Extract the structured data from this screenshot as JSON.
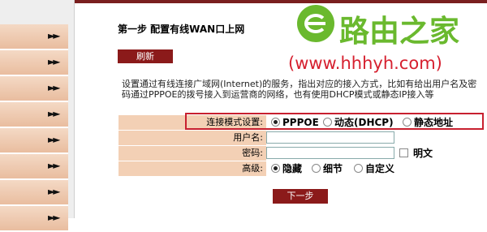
{
  "sidebar": {
    "items": [
      {
        "arrow": "►►"
      },
      {
        "arrow": "►►"
      },
      {
        "arrow": "►►"
      },
      {
        "arrow": "►►"
      },
      {
        "arrow": "►►"
      },
      {
        "arrow": "►►"
      },
      {
        "arrow": "►►"
      },
      {
        "arrow": "►►"
      }
    ]
  },
  "logo": {
    "text": "路由之家",
    "url": "(www.hhhyh.com)",
    "color": "#6ab92e",
    "url_color": "#d6202f"
  },
  "step_title": "第一步 配置有线WAN口上网",
  "refresh_label": "刷新",
  "description": "设置通过有线连接广域网(Internet)的服务，指出对应的接入方式，比如有给出用户名及密码通过PPPOE的拨号接入到运营商的网络，也有使用DHCP模式或静态IP接入等",
  "form": {
    "mode": {
      "label": "连接模式设置:",
      "options": [
        {
          "label": "PPPOE",
          "selected": true
        },
        {
          "label": "动态(DHCP)",
          "selected": false
        },
        {
          "label": "静态地址",
          "selected": false
        }
      ]
    },
    "username": {
      "label": "用户名:",
      "value": ""
    },
    "password": {
      "label": "密码:",
      "value": "",
      "show_label": "明文"
    },
    "advanced": {
      "label": "高级:",
      "options": [
        {
          "label": "隐藏",
          "selected": true
        },
        {
          "label": "细节",
          "selected": false
        },
        {
          "label": "自定义",
          "selected": false
        }
      ]
    }
  },
  "next_label": "下一步",
  "colors": {
    "accent": "#8b1a1a",
    "label_bg": "#f3d0b5",
    "highlight": "#c8202f"
  }
}
